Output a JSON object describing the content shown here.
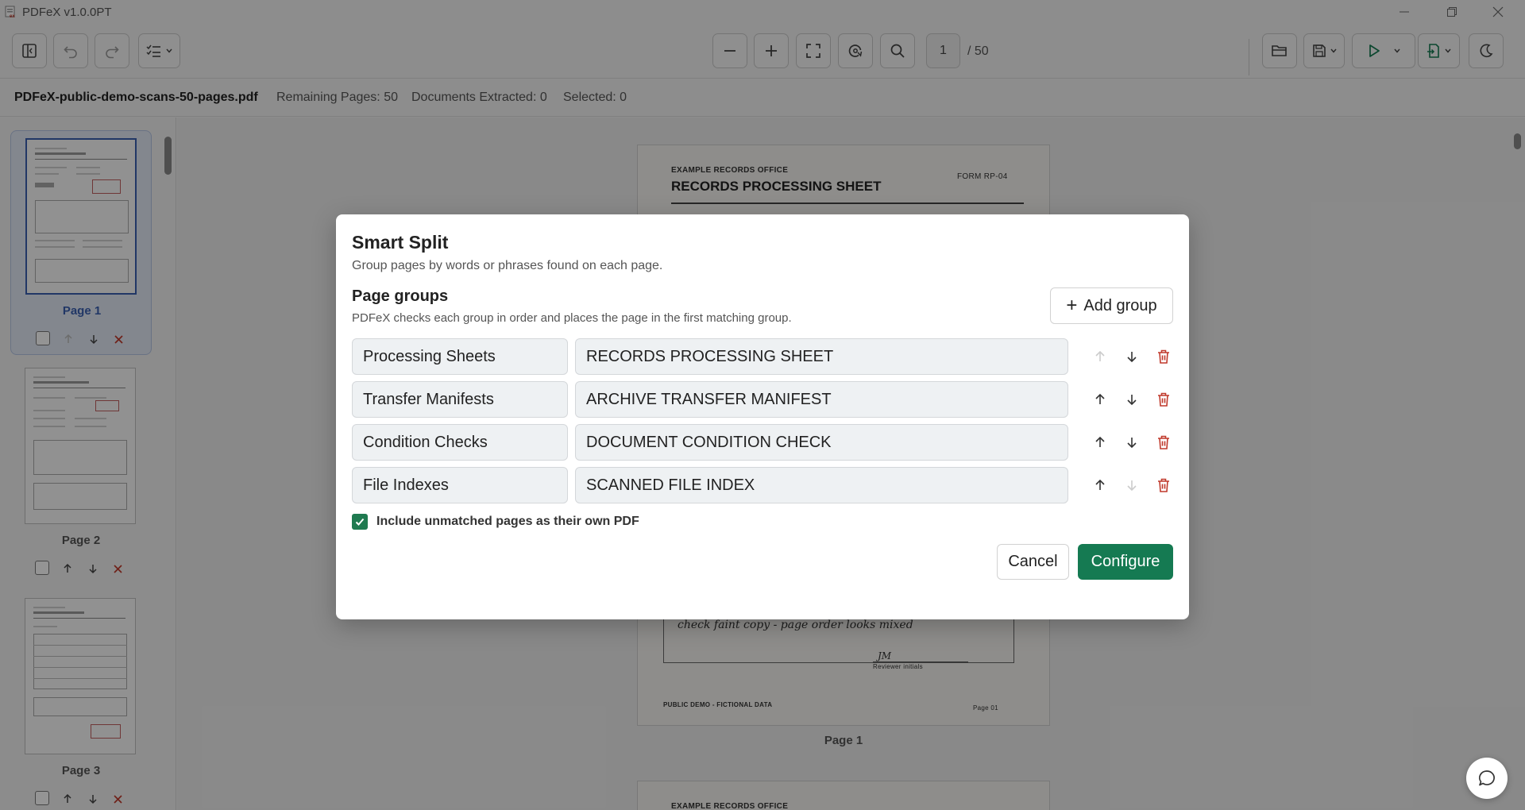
{
  "window": {
    "title": "PDFeX v1.0.0PT",
    "controls": [
      "minimize-icon",
      "restore-icon",
      "close-icon"
    ]
  },
  "toolbar": {
    "page_current": "1",
    "page_total": "/ 50",
    "icons": [
      "sidebar-toggle-icon",
      "undo-icon",
      "redo-icon",
      "checklist-icon",
      "zoom-out-icon",
      "zoom-in-icon",
      "fit-page-icon",
      "rotate-icon",
      "search-icon",
      "open-folder-icon",
      "save-icon",
      "run-icon",
      "export-icon",
      "theme-icon"
    ]
  },
  "status": {
    "filename": "PDFeX-public-demo-scans-50-pages.pdf",
    "remaining": "Remaining Pages: 50",
    "extracted": "Documents Extracted: 0",
    "selected": "Selected: 0"
  },
  "sidebar": {
    "pages": [
      {
        "label": "Page 1",
        "selected": true
      },
      {
        "label": "Page 2",
        "selected": false
      },
      {
        "label": "Page 3",
        "selected": false
      }
    ]
  },
  "document": {
    "office": "EXAMPLE RECORDS OFFICE",
    "title": "RECORDS PROCESSING SHEET",
    "form": "FORM RP-04",
    "note": "check faint copy - page order looks mixed",
    "initials": "JM",
    "initials_label": "Reviewer initials",
    "footer": "PUBLIC DEMO - FICTIONAL DATA",
    "page_no": "Page 01",
    "caption": "Page 1",
    "next_office": "EXAMPLE RECORDS OFFICE"
  },
  "modal": {
    "title": "Smart Split",
    "subtitle": "Group pages by words or phrases found on each page.",
    "section_title": "Page groups",
    "section_subtitle": "PDFeX checks each group in order and places the page in the first matching group.",
    "add_group_label": "Add group",
    "groups": [
      {
        "name": "Processing Sheets",
        "phrase": "RECORDS PROCESSING SHEET",
        "up_enabled": false,
        "down_enabled": true
      },
      {
        "name": "Transfer Manifests",
        "phrase": "ARCHIVE TRANSFER MANIFEST",
        "up_enabled": true,
        "down_enabled": true
      },
      {
        "name": "Condition Checks",
        "phrase": "DOCUMENT CONDITION CHECK",
        "up_enabled": true,
        "down_enabled": true
      },
      {
        "name": "File Indexes",
        "phrase": "SCANNED FILE INDEX",
        "up_enabled": true,
        "down_enabled": false
      }
    ],
    "include_unmatched_label": "Include unmatched pages as their own PDF",
    "include_unmatched_checked": true,
    "cancel_label": "Cancel",
    "configure_label": "Configure"
  },
  "colors": {
    "accent_green": "#157a52",
    "delete_red": "#c0392b",
    "selection_blue": "#3a5fb0"
  }
}
